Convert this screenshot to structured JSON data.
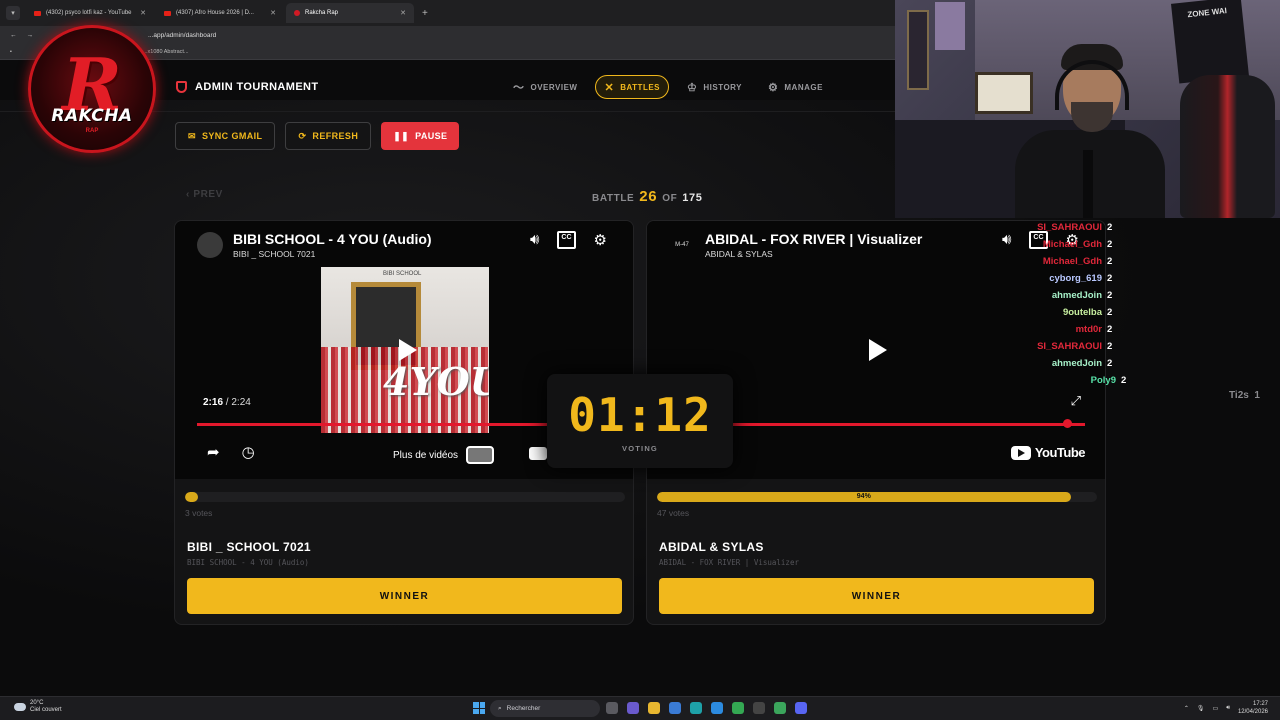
{
  "browser": {
    "tabs": [
      {
        "label": "(4302) psyco lotfi kaz - YouTube",
        "kind": "youtube"
      },
      {
        "label": "(4307) Afro House 2026 | D...",
        "kind": "youtube"
      },
      {
        "label": "Rakcha Rap",
        "kind": "rakcha",
        "active": true
      }
    ],
    "url": "...app/admin/dashboard",
    "bookmark": "...x1080 Abstract..."
  },
  "logo": {
    "letter": "R",
    "word": "RAKCHA",
    "sub": "RAP"
  },
  "nav": {
    "title": "ADMIN TOURNAMENT",
    "items": [
      {
        "label": "OVERVIEW",
        "icon": "pulse-icon",
        "active": false
      },
      {
        "label": "BATTLES",
        "icon": "swords-icon",
        "active": true
      },
      {
        "label": "HISTORY",
        "icon": "trophy-icon",
        "active": false
      },
      {
        "label": "MANAGE",
        "icon": "gear-icon",
        "active": false
      }
    ]
  },
  "actions": {
    "sync": "SYNC GMAIL",
    "refresh": "REFRESH",
    "pause": "PAUSE"
  },
  "battle": {
    "prev": "PREV",
    "label": "BATTLE",
    "current": "26",
    "of": "OF",
    "total": "175"
  },
  "timer": {
    "value": "01:12",
    "label": "VOTING"
  },
  "left": {
    "video_title": "BIBI SCHOOL - 4 YOU (Audio)",
    "channel": "BIBI _ SCHOOL 7021",
    "cover_label": "BIBI SCHOOL",
    "cover_text": "4YOU",
    "time_current": "2:16",
    "time_total": "2:24",
    "more_videos": "Plus de vidéos",
    "vote_percent": 3,
    "votes": "3 votes",
    "artist": "BIBI _ SCHOOL 7021",
    "song": "BIBI SCHOOL - 4 YOU (Audio)",
    "winner": "WINNER"
  },
  "right": {
    "video_title": "ABIDAL - FOX RIVER | Visualizer",
    "channel": "ABIDAL & SYLAS",
    "channel_badge": "M-47",
    "youtube": "YouTube",
    "vote_percent": 94,
    "vote_percent_label": "94%",
    "votes": "47 votes",
    "artist": "ABIDAL & SYLAS",
    "song": "ABIDAL - FOX RIVER | Visualizer",
    "winner": "WINNER"
  },
  "chat": [
    {
      "user": "SI_SAHRAOUI",
      "count": "2",
      "color": "#e0283a"
    },
    {
      "user": "Michael_Gdh",
      "count": "2",
      "color": "#e0283a"
    },
    {
      "user": "Michael_Gdh",
      "count": "2",
      "color": "#e0283a"
    },
    {
      "user": "cyborg_619",
      "count": "2",
      "color": "#b9c8ff"
    },
    {
      "user": "ahmedJoin",
      "count": "2",
      "color": "#a6f0c8"
    },
    {
      "user": "9outelba",
      "count": "2",
      "color": "#c8f0a0"
    },
    {
      "user": "mtd0r",
      "count": "2",
      "color": "#e0283a"
    },
    {
      "user": "SI_SAHRAOUI",
      "count": "2",
      "color": "#e0283a"
    },
    {
      "user": "ahmedJoin",
      "count": "2",
      "color": "#a6f0c8"
    },
    {
      "user": "Poly9",
      "count": "2",
      "color": "#58e2a8"
    }
  ],
  "side_label": {
    "user": "Ti2s",
    "count": "1"
  },
  "cam": {
    "banner": "ZONE WAI"
  },
  "taskbar": {
    "temp": "20°C",
    "weather": "Ciel couvert",
    "search": "Rechercher",
    "time": "17:27",
    "date": "12/04/2026"
  },
  "colors": {
    "accent": "#f1b81c",
    "danger": "#e4343c",
    "bg": "#0d0d0e"
  }
}
